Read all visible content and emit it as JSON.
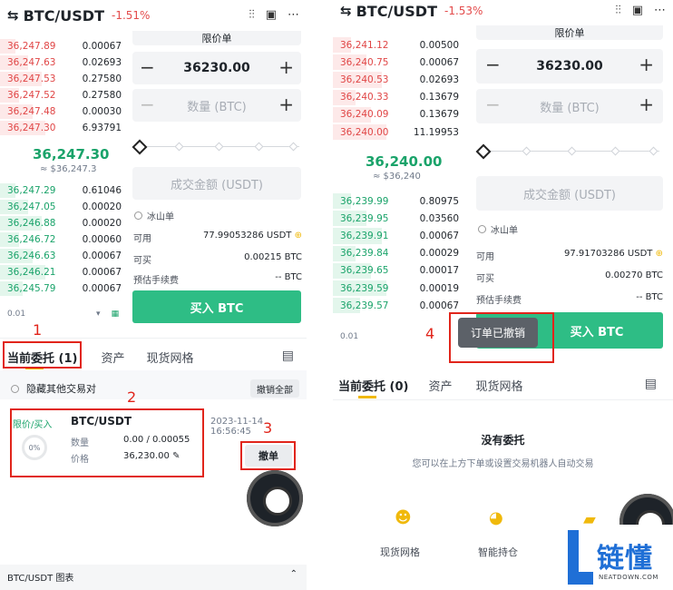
{
  "left": {
    "header": {
      "swap_icon": "⇆",
      "pair": "BTC/USDT",
      "change": "-1.51%"
    },
    "asks": [
      {
        "price": "36,247.89",
        "qty": "0.00067"
      },
      {
        "price": "36,247.63",
        "qty": "0.02693"
      },
      {
        "price": "36,247.53",
        "qty": "0.27580"
      },
      {
        "price": "36,247.52",
        "qty": "0.27580"
      },
      {
        "price": "36,247.48",
        "qty": "0.00030"
      },
      {
        "price": "36,247.30",
        "qty": "6.93791"
      }
    ],
    "mid_price": "36,247.30",
    "mid_sub": "≈ $36,247.3",
    "bids": [
      {
        "price": "36,247.29",
        "qty": "0.61046"
      },
      {
        "price": "36,247.05",
        "qty": "0.00020"
      },
      {
        "price": "36,246.88",
        "qty": "0.00020"
      },
      {
        "price": "36,246.72",
        "qty": "0.00060"
      },
      {
        "price": "36,246.63",
        "qty": "0.00067"
      },
      {
        "price": "36,246.21",
        "qty": "0.00067"
      },
      {
        "price": "36,245.79",
        "qty": "0.00067"
      }
    ],
    "depth": "0.01",
    "order_type": "限价单",
    "price_value": "36230.00",
    "qty_placeholder": "数量 (BTC)",
    "amount_placeholder": "成交金额 (USDT)",
    "iceberg": "冰山单",
    "avail_label": "可用",
    "avail_value": "77.99053286 USDT",
    "buyable_label": "可买",
    "buyable_value": "0.00215 BTC",
    "fee_label": "预估手续费",
    "fee_value": "-- BTC",
    "buy_button": "买入 BTC",
    "tabs": [
      "当前委托 (1)",
      "资产",
      "现货网格"
    ],
    "hide_other": "隐藏其他交易对",
    "cancel_all": "撤销全部",
    "order": {
      "side": "限价/买入",
      "pair": "BTC/USDT",
      "time": "2023-11-14 16:56:45",
      "progress": "0%",
      "qty_label": "数量",
      "qty_value": "0.00 / 0.00055",
      "price_label": "价格",
      "price_value": "36,230.00"
    },
    "cancel_button": "撤单",
    "chart_bar": "BTC/USDT 图表"
  },
  "right": {
    "header": {
      "swap_icon": "⇆",
      "pair": "BTC/USDT",
      "change": "-1.53%"
    },
    "asks": [
      {
        "price": "36,241.12",
        "qty": "0.00500"
      },
      {
        "price": "36,240.75",
        "qty": "0.00067"
      },
      {
        "price": "36,240.53",
        "qty": "0.02693"
      },
      {
        "price": "36,240.33",
        "qty": "0.13679"
      },
      {
        "price": "36,240.09",
        "qty": "0.13679"
      },
      {
        "price": "36,240.00",
        "qty": "11.19953"
      }
    ],
    "mid_price": "36,240.00",
    "mid_sub": "≈ $36,240",
    "bids": [
      {
        "price": "36,239.99",
        "qty": "0.80975"
      },
      {
        "price": "36,239.95",
        "qty": "0.03560"
      },
      {
        "price": "36,239.91",
        "qty": "0.00067"
      },
      {
        "price": "36,239.84",
        "qty": "0.00029"
      },
      {
        "price": "36,239.65",
        "qty": "0.00017"
      },
      {
        "price": "36,239.59",
        "qty": "0.00019"
      },
      {
        "price": "36,239.57",
        "qty": "0.00067"
      }
    ],
    "depth": "0.01",
    "order_type": "限价单",
    "price_value": "36230.00",
    "qty_placeholder": "数量 (BTC)",
    "amount_placeholder": "成交金额 (USDT)",
    "iceberg": "冰山单",
    "avail_label": "可用",
    "avail_value": "97.91703286 USDT",
    "buyable_label": "可买",
    "buyable_value": "0.00270 BTC",
    "fee_label": "预估手续费",
    "fee_value": "-- BTC",
    "buy_button": "买入 BTC",
    "toast": "订单已撤销",
    "tabs": [
      "当前委托 (0)",
      "资产",
      "现货网格"
    ],
    "empty_title": "没有委托",
    "empty_sub": "您可以在上方下单或设置交易机器人自动交易",
    "shortcuts": [
      "现货网格",
      "智能持仓"
    ]
  },
  "annotations": [
    "1",
    "2",
    "3",
    "4"
  ],
  "watermark": {
    "brand": "链懂",
    "site": "NEATDOWN.COM"
  },
  "colors": {
    "ask": "#e04646",
    "bid": "#1aa36a",
    "buy": "#2ebd85",
    "annotation": "#e1251b",
    "accent": "#f0b90b"
  }
}
